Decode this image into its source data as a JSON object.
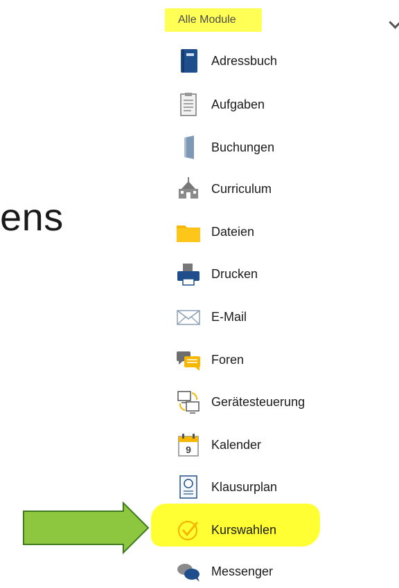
{
  "background_text": "ens",
  "header": {
    "title": "Alle Module"
  },
  "modules": [
    {
      "label": "Adressbuch",
      "icon": "address-book-icon"
    },
    {
      "label": "Aufgaben",
      "icon": "clipboard-icon"
    },
    {
      "label": "Buchungen",
      "icon": "door-icon"
    },
    {
      "label": "Curriculum",
      "icon": "school-building-icon"
    },
    {
      "label": "Dateien",
      "icon": "folder-icon"
    },
    {
      "label": "Drucken",
      "icon": "printer-icon"
    },
    {
      "label": "E-Mail",
      "icon": "envelope-icon"
    },
    {
      "label": "Foren",
      "icon": "forum-icon"
    },
    {
      "label": "Gerätesteuerung",
      "icon": "device-control-icon"
    },
    {
      "label": "Kalender",
      "icon": "calendar-icon"
    },
    {
      "label": "Klausurplan",
      "icon": "exam-plan-icon"
    },
    {
      "label": "Kurswahlen",
      "icon": "checkmark-circle-icon",
      "highlighted": true
    },
    {
      "label": "Messenger",
      "icon": "chat-bubbles-icon"
    }
  ],
  "colors": {
    "highlight": "#ffff33",
    "arrow": "#8dc63f",
    "arrow_border": "#3f7a1f",
    "icon_blue": "#1f4e8c",
    "folder": "#f6b700"
  }
}
